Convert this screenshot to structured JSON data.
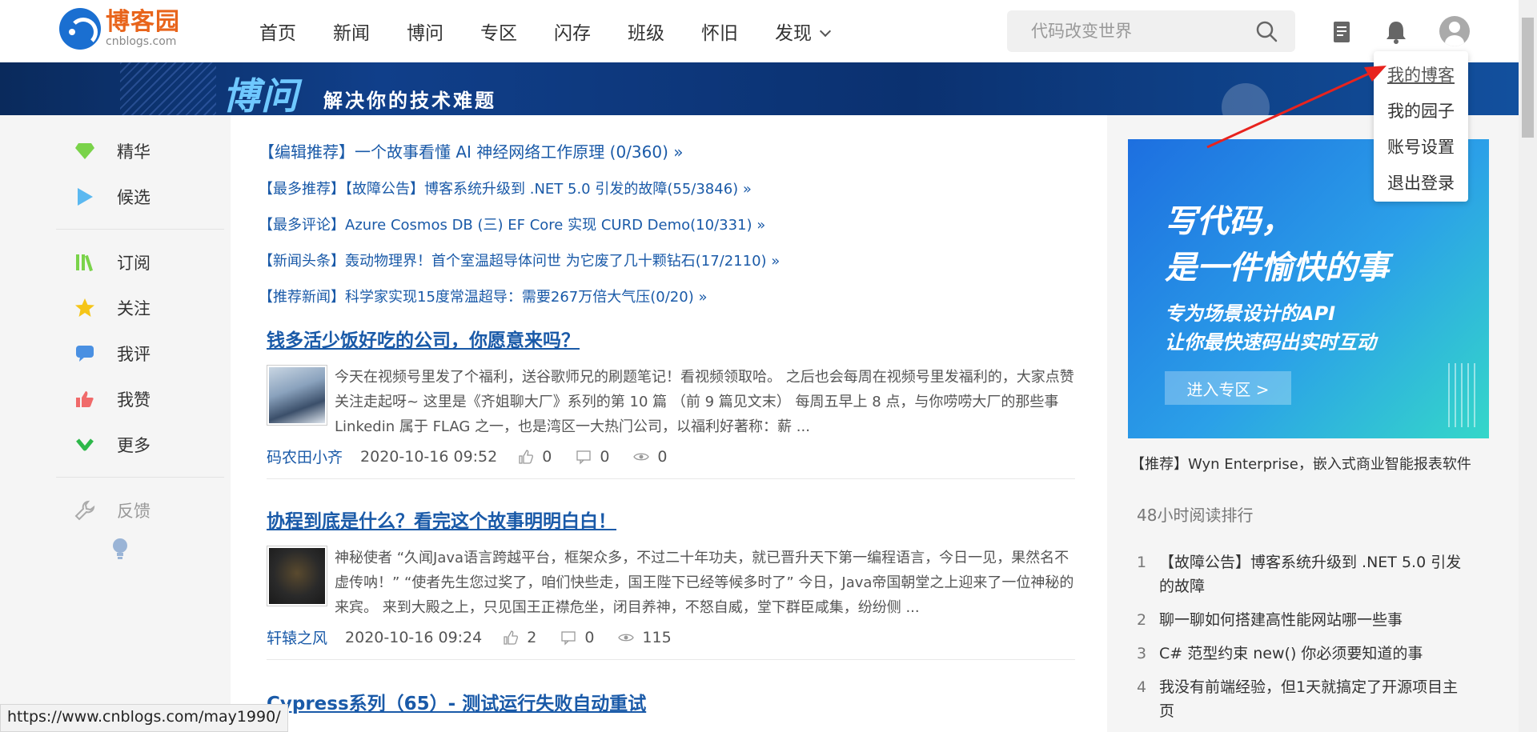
{
  "logo": {
    "cn": "博客园",
    "en": "cnblogs.com"
  },
  "nav": [
    {
      "label": "首页"
    },
    {
      "label": "新闻"
    },
    {
      "label": "博问"
    },
    {
      "label": "专区"
    },
    {
      "label": "闪存"
    },
    {
      "label": "班级"
    },
    {
      "label": "怀旧"
    },
    {
      "label": "发现"
    }
  ],
  "search": {
    "placeholder": "代码改变世界"
  },
  "banner": {
    "title": "博问",
    "subtitle": "解决你的技术难题"
  },
  "sidebar": {
    "group1": [
      {
        "label": "精华",
        "icon": "diamond-icon"
      },
      {
        "label": "候选",
        "icon": "play-icon"
      }
    ],
    "group2": [
      {
        "label": "订阅",
        "icon": "books-icon"
      },
      {
        "label": "关注",
        "icon": "star-icon"
      },
      {
        "label": "我评",
        "icon": "comment-icon"
      },
      {
        "label": "我赞",
        "icon": "thumbs-up-icon"
      },
      {
        "label": "更多",
        "icon": "chevron-down-icon"
      }
    ],
    "feedback": "反馈"
  },
  "recommend": [
    "【编辑推荐】一个故事看懂 AI 神经网络工作原理 (0/360) »",
    "【最多推荐】【故障公告】博客系统升级到 .NET 5.0 引发的故障(55/3846) »",
    "【最多评论】Azure Cosmos DB (三) EF Core 实现 CURD Demo(10/331) »",
    "【新闻头条】轰动物理界！首个室温超导体问世 为它废了几十颗钻石(17/2110) »",
    "【推荐新闻】科学家实现15度常温超导：需要267万倍大气压(0/20) »"
  ],
  "posts": [
    {
      "title": "钱多活少饭好吃的公司，你愿意来吗？",
      "summary": "今天在视频号里发了个福利，送谷歌师兄的刷题笔记！看视频领取哈。 之后也会每周在视频号里发福利的，大家点赞关注走起呀~ 这里是《齐姐聊大厂》系列的第 10 篇 （前 9 篇见文末） 每周五早上 8 点，与你唠唠大厂的那些事 Linkedin 属于 FLAG 之一，也是湾区一大热门公司，以福利好著称：薪 ...",
      "author": "码农田小齐",
      "date": "2020-10-16 09:52",
      "likes": "0",
      "comments": "0",
      "views": "0"
    },
    {
      "title": "协程到底是什么？看完这个故事明明白白！",
      "summary": "神秘使者 “久闻Java语言跨越平台，框架众多，不过二十年功夫，就已晋升天下第一编程语言，今日一见，果然名不虚传呐！” “使者先生您过奖了，咱们快些走，国王陛下已经等候多时了” 今日，Java帝国朝堂之上迎来了一位神秘的来宾。 来到大殿之上，只见国王正襟危坐，闭目养神，不怒自威，堂下群臣咸集，纷纷侧 ...",
      "author": "轩辕之风",
      "date": "2020-10-16 09:24",
      "likes": "2",
      "comments": "0",
      "views": "115"
    },
    {
      "title": "Cypress系列（65）- 测试运行失败自动重试"
    }
  ],
  "ad": {
    "line1": "写代码，",
    "line2": "是一件愉快的事",
    "line3": "专为场景设计的API",
    "line4": "让你最快速码出实时互动",
    "button": "进入专区 >"
  },
  "ad_recommend": "【推荐】Wyn Enterprise，嵌入式商业智能报表软件",
  "ranking": {
    "title": "48小时阅读排行",
    "items": [
      {
        "num": "1",
        "text": "【故障公告】博客系统升级到 .NET 5.0 引发的故障"
      },
      {
        "num": "2",
        "text": "聊一聊如何搭建高性能网站哪一些事"
      },
      {
        "num": "3",
        "text": "C# 范型约束 new() 你必须要知道的事"
      },
      {
        "num": "4",
        "text": "我没有前端经验，但1天就搞定了开源项目主页"
      }
    ]
  },
  "dropdown": [
    "我的博客",
    "我的园子",
    "账号设置",
    "退出登录"
  ],
  "statusbar": "https://www.cnblogs.com/may1990/",
  "colors": {
    "link": "#1a5aa8",
    "accent": "#e8641b",
    "arrow": "#e8231e"
  }
}
